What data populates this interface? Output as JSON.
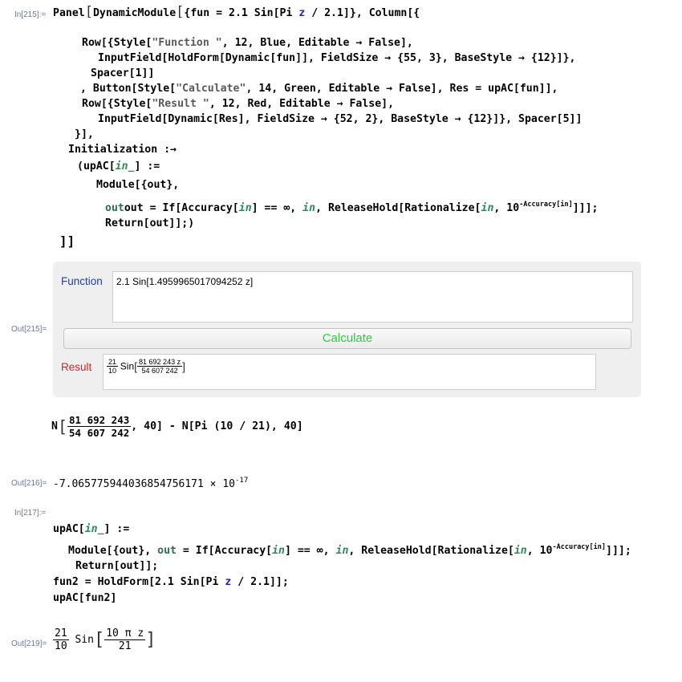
{
  "labels": {
    "in215": "In[215]:=",
    "out215": "Out[215]=",
    "out216": "Out[216]=",
    "in217": "In[217]:=",
    "out219": "Out[219]="
  },
  "input215": {
    "l1_a": "Panel",
    "l1_b": "DynamicModule",
    "l1_c": "{fun = 2.1 Sin[Pi ",
    "l1_z": "z",
    "l1_d": " / 2.1]}, Column[{",
    "l2_a": "Row[{Style[",
    "l2_s": "\"Function \"",
    "l2_b": ", 12, Blue, Editable → False],",
    "l3": "InputField[HoldForm[Dynamic[fun]], FieldSize → {55, 3}, BaseStyle → {12}]},",
    "l4": "Spacer[1]]",
    "l5_a": ", Button[Style[",
    "l5_s": "\"Calculate\"",
    "l5_b": ", 14, Green, Editable → False], Res = upAC[fun]],",
    "l6_a": "Row[{Style[",
    "l6_s": "\"Result \"",
    "l6_b": ", 12, Red, Editable → False],",
    "l7": "InputField[Dynamic[Res], FieldSize → {52, 2}, BaseStyle → {12}]}, Spacer[5]]",
    "l8": "}],",
    "l9": "Initialization :→",
    "l10_a": "(upAC[",
    "l10_p": "in_",
    "l10_b": "] :=",
    "l11": "Module[{out},",
    "l12_a": "out = If[Accuracy[",
    "l12_in": "in",
    "l12_b": "] == ∞, ",
    "l12_in2": "in",
    "l12_c": ", ReleaseHold[Rationalize[",
    "l12_in3": "in",
    "l12_d": ", 10",
    "l12_sup": "-Accuracy[in]",
    "l12_e": "]]];",
    "l13": "Return[out]];)",
    "l14": "]]"
  },
  "panel": {
    "function_label": "Function",
    "function_value": "2.1 Sin[1.4959965017094252 z]",
    "button_label": "Calculate",
    "result_label": "Result",
    "result_frac_num": "21",
    "result_frac_den": "10",
    "result_sin": "Sin",
    "result_arg_num": "81 692 243 z",
    "result_arg_den": "54 607 242"
  },
  "expr": {
    "prefix": "N",
    "num": "81 692 243",
    "den": "54 607 242",
    "suffix": ", 40] - N[Pi (10 / 21), 40]"
  },
  "out216": {
    "mantissa": "-7.065775944036854756171 × 10",
    "exponent": "-17"
  },
  "input217": {
    "l1_a": "upAC[",
    "l1_p": "in_",
    "l1_b": "] :=",
    "l2_a": "Module[{out}, ",
    "l2_out": "out",
    "l2_b": " = If[Accuracy[",
    "l2_in": "in",
    "l2_c": "] == ∞, ",
    "l2_in2": "in",
    "l2_d": ", ReleaseHold[Rationalize[",
    "l2_in3": "in",
    "l2_e": ", 10",
    "l2_sup": "-Accuracy[in]",
    "l2_f": "]]];",
    "l3": "Return[out]];",
    "l4_a": "fun2 = HoldForm[2.1 Sin[Pi ",
    "l4_z": "z",
    "l4_b": " / 2.1]];",
    "l5": "upAC[fun2]"
  },
  "out219": {
    "num": "21",
    "den": "10",
    "sin": "Sin",
    "arg_num": "10 π z",
    "arg_den": "21"
  }
}
